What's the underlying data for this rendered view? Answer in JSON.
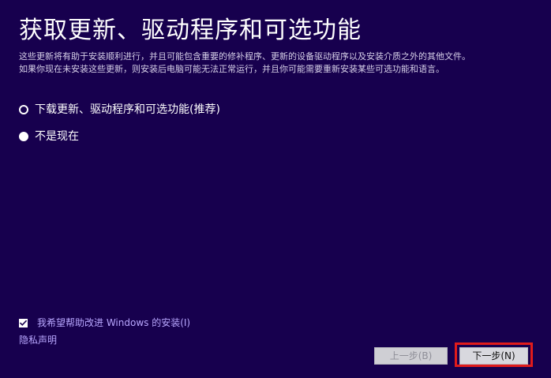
{
  "header": {
    "title": "获取更新、驱动程序和可选功能"
  },
  "description": {
    "line1": "这些更新将有助于安装顺利进行，并且可能包含重要的修补程序、更新的设备驱动程序以及安装介质之外的其他文件。",
    "line2": "如果你现在未安装这些更新，则安装后电脑可能无法正常运行，并且你可能需要重新安装某些可选功能和语言。"
  },
  "options": [
    {
      "label": "下载更新、驱动程序和可选功能(推荐)",
      "selected": true
    },
    {
      "label": "不是现在",
      "selected": false
    }
  ],
  "checkbox": {
    "label": "我希望帮助改进 Windows 的安装(I)",
    "checked": true
  },
  "links": {
    "privacy": "隐私声明"
  },
  "buttons": {
    "back": "上一步(B)",
    "next": "下一步(N)"
  },
  "colors": {
    "background": "#17004e",
    "link": "#b9a7ff",
    "highlight": "#e11b1b"
  }
}
